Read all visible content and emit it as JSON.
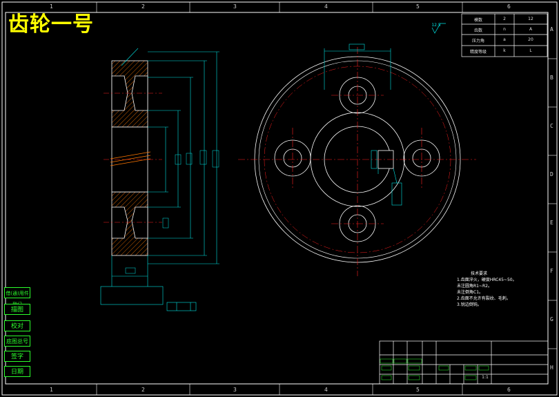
{
  "title": "齿轮一号",
  "zones_top": [
    "1",
    "2",
    "3",
    "4",
    "5",
    "6"
  ],
  "zones_side": [
    "A",
    "B",
    "C",
    "D",
    "E",
    "F",
    "G",
    "H"
  ],
  "param_table": [
    [
      "模数",
      "2",
      "12"
    ],
    [
      "齿数",
      "n",
      "A"
    ],
    [
      "压力角",
      "a",
      "20"
    ],
    [
      "精度等级",
      "k",
      "L"
    ]
  ],
  "roughness": "12.5",
  "tech_notes_title": "技术要求",
  "tech_notes": [
    "1.齿面淬火，硬度HRC45~50。",
    "  未注圆角R1~R2。",
    "  未注倒角C1。",
    "2.齿面不允许有裂纹、毛刺。",
    "3.锐边倒钝。"
  ],
  "side_labels": [
    "借(通)用件登记",
    "描图",
    "校对",
    "底图总号",
    "签字",
    "日期"
  ],
  "title_block": {
    "scale": "1:1"
  },
  "colors": {
    "frame": "#ffffff",
    "dimension": "#00e5e5",
    "centerline": "#ff2020",
    "hatch": "#ff7700",
    "title": "#ffff00",
    "table_green": "#2cff2c"
  }
}
